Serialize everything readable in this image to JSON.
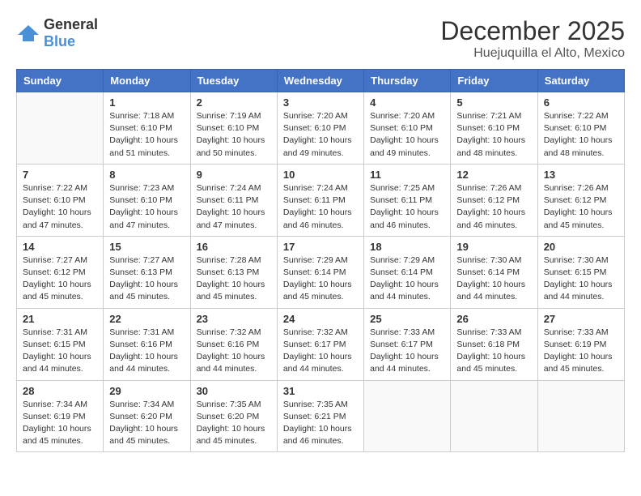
{
  "logo": {
    "general": "General",
    "blue": "Blue"
  },
  "title": "December 2025",
  "location": "Huejuquilla el Alto, Mexico",
  "days_of_week": [
    "Sunday",
    "Monday",
    "Tuesday",
    "Wednesday",
    "Thursday",
    "Friday",
    "Saturday"
  ],
  "weeks": [
    [
      {
        "day": "",
        "info": ""
      },
      {
        "day": "1",
        "info": "Sunrise: 7:18 AM\nSunset: 6:10 PM\nDaylight: 10 hours\nand 51 minutes."
      },
      {
        "day": "2",
        "info": "Sunrise: 7:19 AM\nSunset: 6:10 PM\nDaylight: 10 hours\nand 50 minutes."
      },
      {
        "day": "3",
        "info": "Sunrise: 7:20 AM\nSunset: 6:10 PM\nDaylight: 10 hours\nand 49 minutes."
      },
      {
        "day": "4",
        "info": "Sunrise: 7:20 AM\nSunset: 6:10 PM\nDaylight: 10 hours\nand 49 minutes."
      },
      {
        "day": "5",
        "info": "Sunrise: 7:21 AM\nSunset: 6:10 PM\nDaylight: 10 hours\nand 48 minutes."
      },
      {
        "day": "6",
        "info": "Sunrise: 7:22 AM\nSunset: 6:10 PM\nDaylight: 10 hours\nand 48 minutes."
      }
    ],
    [
      {
        "day": "7",
        "info": "Sunrise: 7:22 AM\nSunset: 6:10 PM\nDaylight: 10 hours\nand 47 minutes."
      },
      {
        "day": "8",
        "info": "Sunrise: 7:23 AM\nSunset: 6:10 PM\nDaylight: 10 hours\nand 47 minutes."
      },
      {
        "day": "9",
        "info": "Sunrise: 7:24 AM\nSunset: 6:11 PM\nDaylight: 10 hours\nand 47 minutes."
      },
      {
        "day": "10",
        "info": "Sunrise: 7:24 AM\nSunset: 6:11 PM\nDaylight: 10 hours\nand 46 minutes."
      },
      {
        "day": "11",
        "info": "Sunrise: 7:25 AM\nSunset: 6:11 PM\nDaylight: 10 hours\nand 46 minutes."
      },
      {
        "day": "12",
        "info": "Sunrise: 7:26 AM\nSunset: 6:12 PM\nDaylight: 10 hours\nand 46 minutes."
      },
      {
        "day": "13",
        "info": "Sunrise: 7:26 AM\nSunset: 6:12 PM\nDaylight: 10 hours\nand 45 minutes."
      }
    ],
    [
      {
        "day": "14",
        "info": "Sunrise: 7:27 AM\nSunset: 6:12 PM\nDaylight: 10 hours\nand 45 minutes."
      },
      {
        "day": "15",
        "info": "Sunrise: 7:27 AM\nSunset: 6:13 PM\nDaylight: 10 hours\nand 45 minutes."
      },
      {
        "day": "16",
        "info": "Sunrise: 7:28 AM\nSunset: 6:13 PM\nDaylight: 10 hours\nand 45 minutes."
      },
      {
        "day": "17",
        "info": "Sunrise: 7:29 AM\nSunset: 6:14 PM\nDaylight: 10 hours\nand 45 minutes."
      },
      {
        "day": "18",
        "info": "Sunrise: 7:29 AM\nSunset: 6:14 PM\nDaylight: 10 hours\nand 44 minutes."
      },
      {
        "day": "19",
        "info": "Sunrise: 7:30 AM\nSunset: 6:14 PM\nDaylight: 10 hours\nand 44 minutes."
      },
      {
        "day": "20",
        "info": "Sunrise: 7:30 AM\nSunset: 6:15 PM\nDaylight: 10 hours\nand 44 minutes."
      }
    ],
    [
      {
        "day": "21",
        "info": "Sunrise: 7:31 AM\nSunset: 6:15 PM\nDaylight: 10 hours\nand 44 minutes."
      },
      {
        "day": "22",
        "info": "Sunrise: 7:31 AM\nSunset: 6:16 PM\nDaylight: 10 hours\nand 44 minutes."
      },
      {
        "day": "23",
        "info": "Sunrise: 7:32 AM\nSunset: 6:16 PM\nDaylight: 10 hours\nand 44 minutes."
      },
      {
        "day": "24",
        "info": "Sunrise: 7:32 AM\nSunset: 6:17 PM\nDaylight: 10 hours\nand 44 minutes."
      },
      {
        "day": "25",
        "info": "Sunrise: 7:33 AM\nSunset: 6:17 PM\nDaylight: 10 hours\nand 44 minutes."
      },
      {
        "day": "26",
        "info": "Sunrise: 7:33 AM\nSunset: 6:18 PM\nDaylight: 10 hours\nand 45 minutes."
      },
      {
        "day": "27",
        "info": "Sunrise: 7:33 AM\nSunset: 6:19 PM\nDaylight: 10 hours\nand 45 minutes."
      }
    ],
    [
      {
        "day": "28",
        "info": "Sunrise: 7:34 AM\nSunset: 6:19 PM\nDaylight: 10 hours\nand 45 minutes."
      },
      {
        "day": "29",
        "info": "Sunrise: 7:34 AM\nSunset: 6:20 PM\nDaylight: 10 hours\nand 45 minutes."
      },
      {
        "day": "30",
        "info": "Sunrise: 7:35 AM\nSunset: 6:20 PM\nDaylight: 10 hours\nand 45 minutes."
      },
      {
        "day": "31",
        "info": "Sunrise: 7:35 AM\nSunset: 6:21 PM\nDaylight: 10 hours\nand 46 minutes."
      },
      {
        "day": "",
        "info": ""
      },
      {
        "day": "",
        "info": ""
      },
      {
        "day": "",
        "info": ""
      }
    ]
  ]
}
